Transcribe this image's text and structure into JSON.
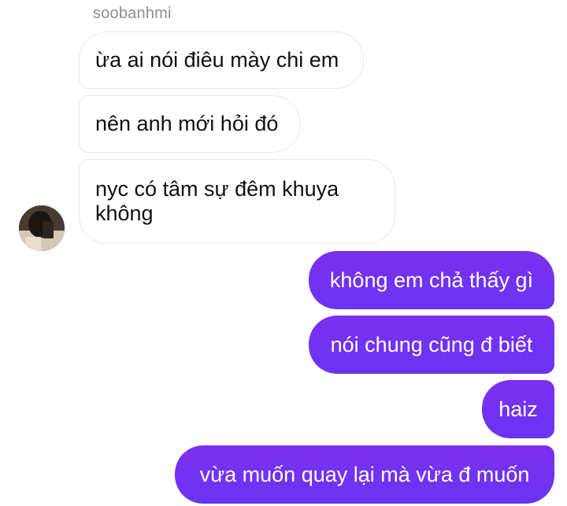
{
  "conversation": {
    "sender_name": "soobanhmi",
    "incoming": [
      {
        "text": "ừa ai nói điêu mày chi em"
      },
      {
        "text": "nên anh mới hỏi đó"
      },
      {
        "text": "nyc có tâm sự đêm khuya\nkhông"
      }
    ],
    "outgoing": [
      {
        "text": "không em chả thấy gì"
      },
      {
        "text": "nói chung cũng đ biết"
      },
      {
        "text": "haiz"
      },
      {
        "text": "vừa muốn quay lại mà vừa đ muốn"
      }
    ],
    "colors": {
      "outgoing_bubble": "#7032f0",
      "incoming_bubble": "#ffffff",
      "incoming_border": "#e9e9e9",
      "sender_name": "#8e8e8e"
    },
    "avatar": {
      "icon": "user-avatar"
    }
  }
}
